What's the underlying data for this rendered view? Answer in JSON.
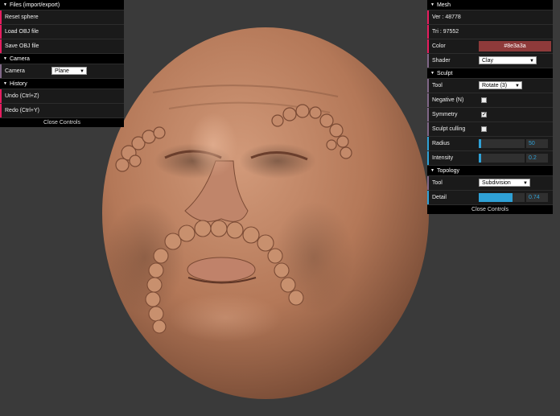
{
  "colors": {
    "background": "#3a3a3a",
    "skin": "#b2775a",
    "mesh_color": "#8e3a3a",
    "slider_accent": "#2fa1d6"
  },
  "left": {
    "files": {
      "title": "Files (import/export)",
      "reset": "Reset sphere",
      "load": "Load OBJ file",
      "save": "Save OBJ file"
    },
    "camera": {
      "title": "Camera",
      "label": "Camera",
      "value": "Plane"
    },
    "history": {
      "title": "History",
      "undo": "Undo (Ctrl+Z)",
      "redo": "Redo (Ctrl+Y)"
    },
    "close": "Close Controls"
  },
  "right": {
    "mesh": {
      "title": "Mesh",
      "ver": "Ver : 48778",
      "tri": "Tri : 97552",
      "color_label": "Color",
      "color_value": "#8e3a3a",
      "shader_label": "Shader",
      "shader_value": "Clay"
    },
    "sculpt": {
      "title": "Sculpt",
      "tool_label": "Tool",
      "tool_value": "Rotate (3)",
      "negative_label": "Negative (N)",
      "negative_checked": false,
      "symmetry_label": "Symmetry",
      "symmetry_checked": true,
      "culling_label": "Sculpt culling",
      "culling_checked": false,
      "radius_label": "Radius",
      "radius_value": "50",
      "radius_fraction": 0.05,
      "intensity_label": "Intensity",
      "intensity_value": "0.2",
      "intensity_fraction": 0.05
    },
    "topology": {
      "title": "Topology",
      "tool_label": "Tool",
      "tool_value": "Subdivision",
      "detail_label": "Detail",
      "detail_value": "0.74",
      "detail_fraction": 0.74
    },
    "close": "Close Controls"
  }
}
